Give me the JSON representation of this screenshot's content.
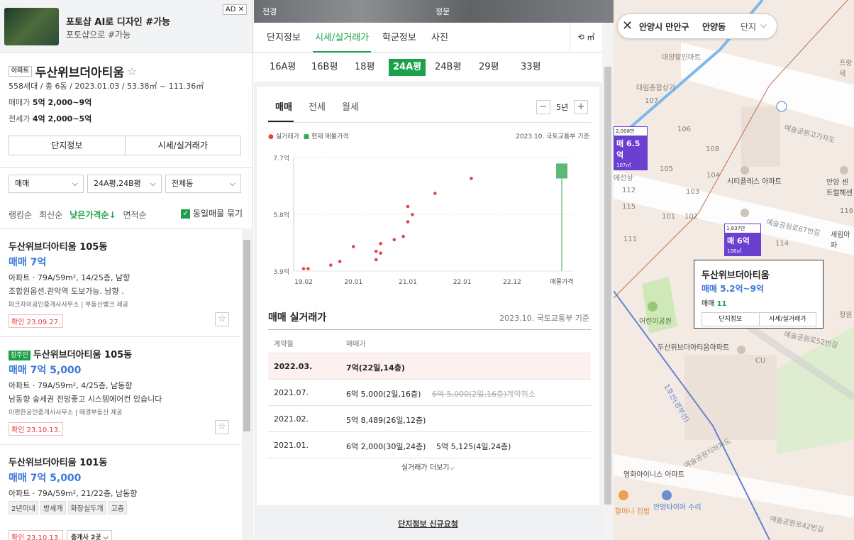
{
  "ad": {
    "title": "포토샵 AI로 디자인 #가능",
    "subtitle": "포토샵으로 #가능",
    "tag": "AD",
    "close": "✕"
  },
  "complex": {
    "type_tag": "아파트",
    "name": "두산위브더아티움",
    "meta": "558세대 / 총 6동 / 2023.01.03 / 53.38㎡ ~ 111.36㎡",
    "sale_label": "매매가",
    "sale_value": "5억 2,000~9억",
    "jeonse_label": "전세가",
    "jeonse_value": "4억 2,000~5억",
    "btn_info": "단지정보",
    "btn_price": "시세/실거래가"
  },
  "filters": {
    "deal": "매매",
    "area": "24A평,24B평",
    "dong": "전체동"
  },
  "sorts": [
    "랭킹순",
    "최신순",
    "낮은가격순↓",
    "면적순"
  ],
  "same_listing": "동일매물 묶기",
  "listings": [
    {
      "title": "두산위브더아티움 105동",
      "price": "매매 7억",
      "d1": "아파트 · 79A/59m², 14/25층, 남향",
      "d2": "조합원옵션.관악역 도보가능. 남향 .",
      "d3": "파크자이공인중개사사무소 | 부동산뱅크 제공",
      "confirm": "확인 23.09.27."
    },
    {
      "tag": "집주인",
      "title": "두산위브더아티움 105동",
      "price": "매매 7억 5,000",
      "d1": "아파트 · 79A/59m², 4/25층, 남동향",
      "d2": "남동향 숲세권 전망좋고 시스템에어컨 있습니다",
      "d3": "이편한공인중개사사무소 | 매경부동산 제공",
      "confirm": "확인 23.10.13."
    },
    {
      "title": "두산위브더아티움 101동",
      "price": "매매 7억 5,000",
      "d1": "아파트 · 79A/59m², 21/22층, 남동향",
      "tags": [
        "2년이내",
        "방세개",
        "화장실두개",
        "고층"
      ],
      "confirm": "확인 23.10.13.",
      "agent": "중개사 2곳 ⌵"
    }
  ],
  "photo": {
    "l1": "전경",
    "l2": "정문"
  },
  "tabs": [
    "단지정보",
    "시세/실거래가",
    "학군정보",
    "사진"
  ],
  "unit_btn": "⟲ ㎡",
  "pyeong": [
    "16A평",
    "16B평",
    "18평",
    "24A평",
    "24B평",
    "29평",
    "33평"
  ],
  "chart_tabs": [
    "매매",
    "전세",
    "월세"
  ],
  "year_ctl": {
    "minus": "−",
    "label": "5년",
    "plus": "+"
  },
  "legend": {
    "real": "실거래가",
    "current": "현재 매물가격",
    "source": "2023.10. 국토교통부 기준"
  },
  "chart_data": {
    "type": "scatter",
    "title": "",
    "ylim": [
      3.9,
      7.7
    ],
    "yticks": [
      "7.7억",
      "5.8억",
      "3.9억"
    ],
    "xticks": [
      "19.02",
      "20.01",
      "21.01",
      "22.01",
      "22.12",
      "매물가격"
    ],
    "points": [
      {
        "x": "2019-02",
        "y": 3.98
      },
      {
        "x": "2019-03",
        "y": 3.98
      },
      {
        "x": "2019-08",
        "y": 4.1
      },
      {
        "x": "2019-10",
        "y": 4.22
      },
      {
        "x": "2020-01",
        "y": 4.72
      },
      {
        "x": "2020-06",
        "y": 4.56
      },
      {
        "x": "2020-06",
        "y": 4.28
      },
      {
        "x": "2020-07",
        "y": 4.5
      },
      {
        "x": "2020-07",
        "y": 4.82
      },
      {
        "x": "2020-10",
        "y": 4.95
      },
      {
        "x": "2020-12",
        "y": 5.06
      },
      {
        "x": "2021-01",
        "y": 5.55
      },
      {
        "x": "2021-01",
        "y": 6.06
      },
      {
        "x": "2021-02",
        "y": 5.79
      },
      {
        "x": "2021-07",
        "y": 6.5
      },
      {
        "x": "2022-03",
        "y": 7.0
      }
    ],
    "current_range": [
      7.0,
      7.5
    ],
    "series": [
      {
        "name": "실거래가",
        "color": "#e04646"
      },
      {
        "name": "현재 매물가격",
        "color": "#35a853"
      }
    ]
  },
  "trade": {
    "title": "매매 실거래가",
    "source": "2023.10. 국토교통부 기준",
    "head": [
      "계약월",
      "매매가"
    ],
    "rows": [
      {
        "month": "2022.03.",
        "price": "7억(22일,14층)",
        "extra": ""
      },
      {
        "month": "2021.07.",
        "price": "6억 5,000(2일,16층)",
        "extra": "6억 5,000(2일,16층)",
        "note": "계약취소"
      },
      {
        "month": "2021.02.",
        "price": "5억 8,489(26일,12층)",
        "extra": ""
      },
      {
        "month": "2021.01.",
        "price": "6억 2,000(30일,24층)",
        "extra": "5억 5,125(4일,24층)"
      }
    ],
    "more": "실거래가 더보기⌵"
  },
  "new_request": "단지정보 신규요청",
  "search": {
    "city": "안양시 만안구",
    "dong": "안양동",
    "complex": "단지",
    "chev": "⌵"
  },
  "map": {
    "pin1": {
      "top": "2,008만",
      "price": "매 6.5억",
      "area": "107㎡"
    },
    "pin2": {
      "top": "1,837만",
      "price": "매 6억",
      "area": "108㎡"
    },
    "labels": [
      "대양할인마트",
      "대림종합상가",
      "예술공원고가차도",
      "시티플레스 아파트",
      "안양 센트럴헤센",
      "세림아파",
      "어린이공원",
      "두산위브더아티움아파트",
      "영화아이니스 아파트",
      "안양타이어 수리",
      "프랑세",
      "에선상",
      "정원",
      "예술공원로67번길",
      "예술공원로52번길",
      "예술공원로42번길",
      "예술공원지하차도",
      "1호선(경부선)",
      "할머니 김밥"
    ],
    "numbers": [
      "107",
      "106",
      "108",
      "105",
      "103",
      "104",
      "101",
      "102",
      "112",
      "115",
      "111",
      "113",
      "114",
      "116",
      "CU"
    ]
  },
  "popup": {
    "title": "두산위브더아티움",
    "price": "매매 5.2억~9억",
    "count_label": "매매",
    "count": "11",
    "btn1": "단지정보",
    "btn2": "시세/실거래가"
  }
}
